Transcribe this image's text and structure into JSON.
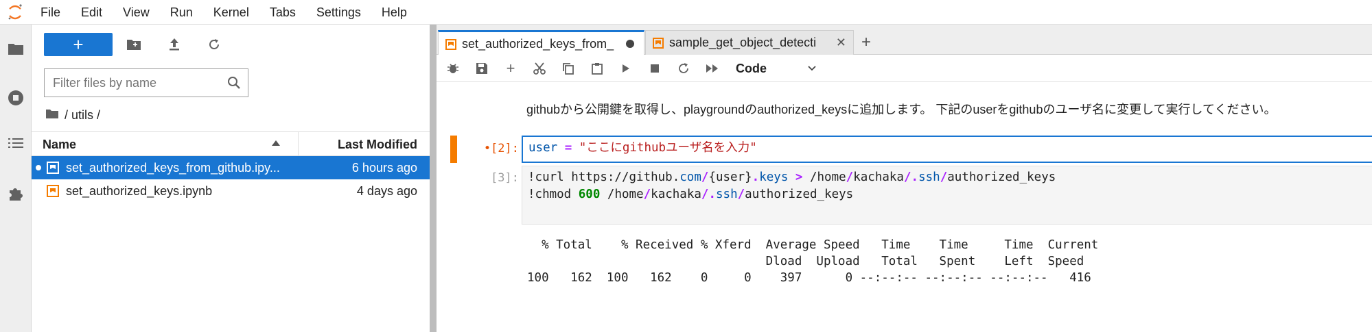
{
  "menu": [
    "File",
    "Edit",
    "View",
    "Run",
    "Kernel",
    "Tabs",
    "Settings",
    "Help"
  ],
  "filebrowser": {
    "new_label": "+",
    "filter_placeholder": "Filter files by name",
    "breadcrumb": "/ utils /",
    "col_name": "Name",
    "col_modified": "Last Modified",
    "files": [
      {
        "name": "set_authorized_keys_from_github.ipy...",
        "modified": "6 hours ago",
        "selected": true
      },
      {
        "name": "set_authorized_keys.ipynb",
        "modified": "4 days ago",
        "selected": false
      }
    ]
  },
  "tabs": [
    {
      "label": "set_authorized_keys_from_",
      "active": true
    },
    {
      "label": "sample_get_object_detecti",
      "active": false
    }
  ],
  "tab_add": "+",
  "toolbar": {
    "cell_type": "Code"
  },
  "markdown_text": "githubから公開鍵を取得し、playgroundのauthorized_keysに追加します。 下記のuserをgithubのユーザ名に変更して実行してください。",
  "cells": [
    {
      "prompt": "•[2]:"
    },
    {
      "prompt": "[3]:"
    }
  ],
  "cell2": {
    "var": "user",
    "op": "=",
    "str": "\"ここにgithubユーザ名を入力\""
  },
  "cell3": {
    "line1": [
      "!curl https://github.",
      "com",
      "/",
      "{",
      "user",
      "}",
      ".",
      "keys",
      " > ",
      "/home",
      "/",
      "kachaka",
      "/",
      ".",
      "ssh",
      "/",
      "authorized_keys"
    ],
    "line2": [
      "!chmod ",
      "600",
      " ",
      "/home",
      "/",
      "kachaka",
      "/",
      ".",
      "ssh",
      "/",
      "authorized_keys"
    ]
  },
  "output_lines": [
    "  % Total    % Received % Xferd  Average Speed   Time    Time     Time  Current",
    "                                 Dload  Upload   Total   Spent    Left  Speed",
    "100   162  100   162    0     0    397      0 --:--:-- --:--:-- --:--:--   416"
  ],
  "colors": {
    "accent": "#1976d2",
    "notebook": "#f57c00",
    "active_cell": "#f57c00"
  }
}
